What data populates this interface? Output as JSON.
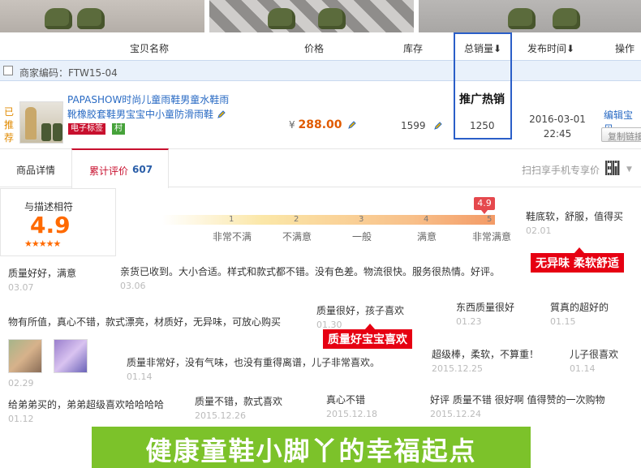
{
  "columns": {
    "name": "宝贝名称",
    "price": "价格",
    "stock": "库存",
    "total_sales": "总销量",
    "publish_time": "发布时间",
    "action": "操作"
  },
  "merchant_code": "商家编码：FTW15-04",
  "product": {
    "recommended": "已推荐",
    "title": "PAPASHOW时尚儿童雨鞋男童水鞋雨靴橡胶套鞋男宝宝中小童防滑雨鞋",
    "tag_etag": "电子标签",
    "tag_village": "村",
    "currency": "¥",
    "price": "288.00",
    "stock": "1599",
    "promo_label": "推广热销",
    "sales": "1250",
    "date": "2016-03-01",
    "time": "22:45",
    "edit": "编辑宝贝",
    "copy_link": "复制链接"
  },
  "tabs": {
    "details": "商品详情",
    "reviews": "累计评价",
    "review_count": "607",
    "mobile_scan": "扫扫享手机专享价"
  },
  "rating": {
    "label": "与描述相符",
    "score": "4.9",
    "stars": "★★★★★",
    "bubble": "4.9",
    "ticks": [
      "1",
      "2",
      "3",
      "4",
      "5"
    ],
    "labels": [
      "非常不满",
      "不满意",
      "一般",
      "满意",
      "非常满意"
    ]
  },
  "reviews": [
    {
      "text": "鞋底软，舒服，值得买",
      "date": "02.01"
    },
    {
      "text": "质量好好，满意",
      "date": "03.07"
    },
    {
      "text": "亲货已收到。大小合适。样式和款式都不错。没有色差。物流很快。服务很热情。好评。",
      "date": "03.06"
    },
    {
      "text": "物有所值，真心不错，款式漂亮，材质好，无异味，可放心购买",
      "date": ""
    },
    {
      "text": "质量很好，孩子喜欢",
      "date": "01.30"
    },
    {
      "text": "东西质量很好",
      "date": "01.23"
    },
    {
      "text": "質真的超好的",
      "date": "01.15"
    },
    {
      "text": "",
      "date": "02.29"
    },
    {
      "text": "质量非常好，没有气味，也没有重得离谱，儿子非常喜欢。",
      "date": "01.14"
    },
    {
      "text": "超级棒，柔软，不算重！",
      "date": "2015.12.25"
    },
    {
      "text": "儿子很喜欢",
      "date": "01.14"
    },
    {
      "text": "给弟弟买的，弟弟超级喜欢哈哈哈哈",
      "date": "01.12"
    },
    {
      "text": "质量不错，款式喜欢",
      "date": "2015.12.26"
    },
    {
      "text": "真心不错",
      "date": "2015.12.18"
    },
    {
      "text": "好评 质量不错 很好啊 值得赞的一次购物",
      "date": "2015.12.24"
    }
  ],
  "banners": {
    "no_odor": "无异味 柔软舒适",
    "kids_love": "质量好宝宝喜欢",
    "promo": "健康童鞋小脚丫的幸福起点"
  },
  "colors": {
    "accent_red": "#c8102e",
    "link_blue": "#2a6bc4",
    "price_orange": "#e05a00",
    "promo_green": "#7cc22a",
    "highlight_box": "#2a5ec8"
  }
}
